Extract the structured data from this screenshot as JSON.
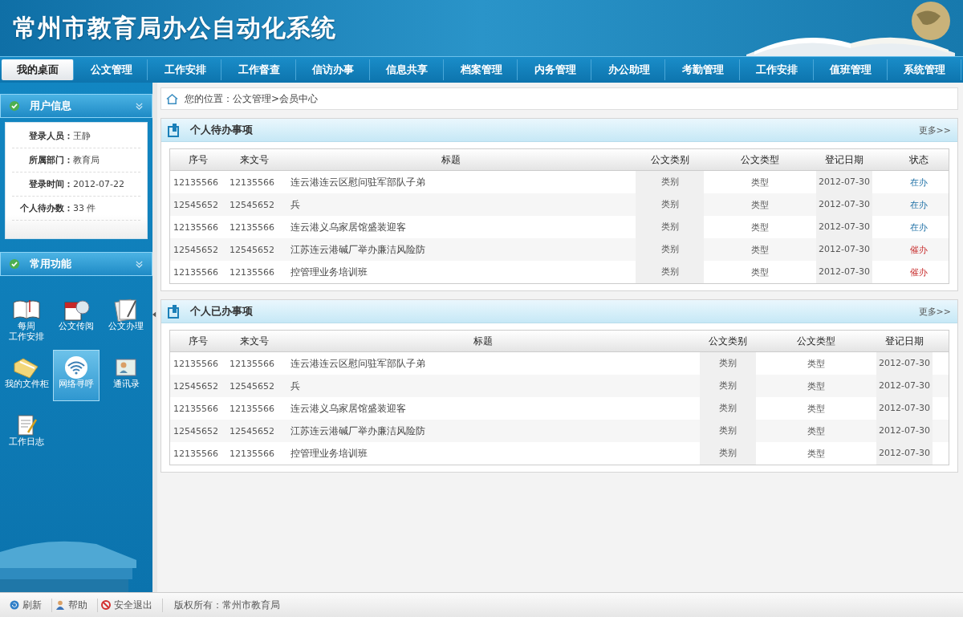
{
  "header": {
    "title": "常州市教育局办公自动化系统"
  },
  "nav": [
    {
      "label": "我的桌面",
      "selected": true
    },
    {
      "label": "公文管理",
      "selected": false
    },
    {
      "label": "工作安排",
      "selected": false
    },
    {
      "label": "工作督查",
      "selected": false
    },
    {
      "label": "信访办事",
      "selected": false
    },
    {
      "label": "信息共享",
      "selected": false
    },
    {
      "label": "档案管理",
      "selected": false
    },
    {
      "label": "内务管理",
      "selected": false
    },
    {
      "label": "办公助理",
      "selected": false
    },
    {
      "label": "考勤管理",
      "selected": false
    },
    {
      "label": "工作安排",
      "selected": false
    },
    {
      "label": "值班管理",
      "selected": false
    },
    {
      "label": "系统管理",
      "selected": false
    }
  ],
  "user_info": {
    "title": "用户信息",
    "rows": [
      {
        "label": "登录人员：",
        "value": "王静"
      },
      {
        "label": "所属部门：",
        "value": "教育局"
      },
      {
        "label": "登录时间：",
        "value": "2012-07-22"
      },
      {
        "label": "个人待办数：",
        "value": "33 件"
      }
    ]
  },
  "functions": {
    "title": "常用功能",
    "items": [
      {
        "lines": [
          "每周",
          "工作安排"
        ],
        "selected": false
      },
      {
        "lines": [
          "公文传阅"
        ],
        "selected": false
      },
      {
        "lines": [
          "公文办理"
        ],
        "selected": false
      },
      {
        "lines": [
          "我的文件柜"
        ],
        "selected": false
      },
      {
        "lines": [
          "网络寻呼"
        ],
        "selected": true
      },
      {
        "lines": [
          "通讯录"
        ],
        "selected": false
      },
      {
        "lines": [
          "工作日志"
        ],
        "selected": false
      }
    ]
  },
  "breadcrumb": {
    "prefix": "您的位置：",
    "path": "公文管理>会员中心"
  },
  "pending": {
    "title": "个人待办事项",
    "more": "更多>>",
    "columns": [
      "序号",
      "来文号",
      "标题",
      "公文类别",
      "公文类型",
      "登记日期",
      "状态"
    ],
    "rows": [
      {
        "cells": [
          "12135566",
          "12135566",
          "连云港连云区慰问驻军部队子弟",
          "类别",
          "类型",
          "2012-07-30"
        ],
        "status": "在办",
        "urgent": false
      },
      {
        "cells": [
          "12545652",
          "12545652",
          "兵",
          "类别",
          "类型",
          "2012-07-30"
        ],
        "status": "在办",
        "urgent": false
      },
      {
        "cells": [
          "12135566",
          "12135566",
          "连云港义乌家居馆盛装迎客",
          "类别",
          "类型",
          "2012-07-30"
        ],
        "status": "在办",
        "urgent": false
      },
      {
        "cells": [
          "12545652",
          "12545652",
          "江苏连云港碱厂举办廉洁风险防",
          "类别",
          "类型",
          "2012-07-30"
        ],
        "status": "催办",
        "urgent": true
      },
      {
        "cells": [
          "12135566",
          "12135566",
          "控管理业务培训班",
          "类别",
          "类型",
          "2012-07-30"
        ],
        "status": "催办",
        "urgent": true
      }
    ]
  },
  "done": {
    "title": "个人已办事项",
    "more": "更多>>",
    "columns": [
      "序号",
      "来文号",
      "标题",
      "公文类别",
      "公文类型",
      "登记日期"
    ],
    "rows": [
      [
        "12135566",
        "12135566",
        "连云港连云区慰问驻军部队子弟",
        "类别",
        "类型",
        "2012-07-30"
      ],
      [
        "12545652",
        "12545652",
        "兵",
        "类别",
        "类型",
        "2012-07-30"
      ],
      [
        "12135566",
        "12135566",
        "连云港义乌家居馆盛装迎客",
        "类别",
        "类型",
        "2012-07-30"
      ],
      [
        "12545652",
        "12545652",
        "江苏连云港碱厂举办廉洁风险防",
        "类别",
        "类型",
        "2012-07-30"
      ],
      [
        "12135566",
        "12135566",
        "控管理业务培训班",
        "类别",
        "类型",
        "2012-07-30"
      ]
    ]
  },
  "footer": {
    "links": [
      "刷新",
      "帮助",
      "安全退出"
    ],
    "copyright": "版权所有：常州市教育局"
  }
}
